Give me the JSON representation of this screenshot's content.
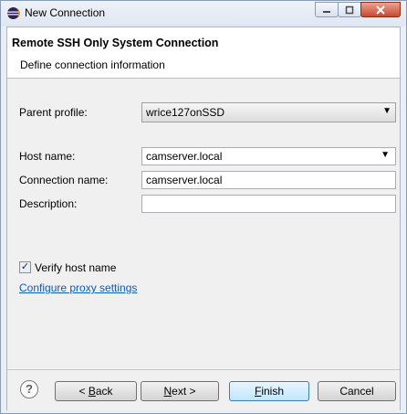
{
  "window": {
    "title": "New Connection"
  },
  "banner": {
    "title": "Remote SSH Only System Connection",
    "subtitle": "Define connection information"
  },
  "form": {
    "parent_profile_label": "Parent profile:",
    "parent_profile_value": "wrice127onSSD",
    "host_name_label": "Host name:",
    "host_name_value": "camserver.local",
    "connection_name_label": "Connection name:",
    "connection_name_value": "camserver.local",
    "description_label": "Description:",
    "description_value": "",
    "verify_label": "Verify host name",
    "verify_checked": true,
    "proxy_link": "Configure proxy settings"
  },
  "buttons": {
    "back_prefix": "< ",
    "back_mnemonic": "B",
    "back_rest": "ack",
    "next_mnemonic": "N",
    "next_rest": "ext >",
    "finish_mnemonic": "F",
    "finish_rest": "inish",
    "cancel": "Cancel"
  },
  "icons": {
    "app": "eclipse-icon",
    "minimize": "minimize-icon",
    "maximize": "maximize-icon",
    "close": "close-icon",
    "help": "help-icon",
    "dropdown": "chevron-down-icon",
    "check": "checkmark-icon"
  }
}
